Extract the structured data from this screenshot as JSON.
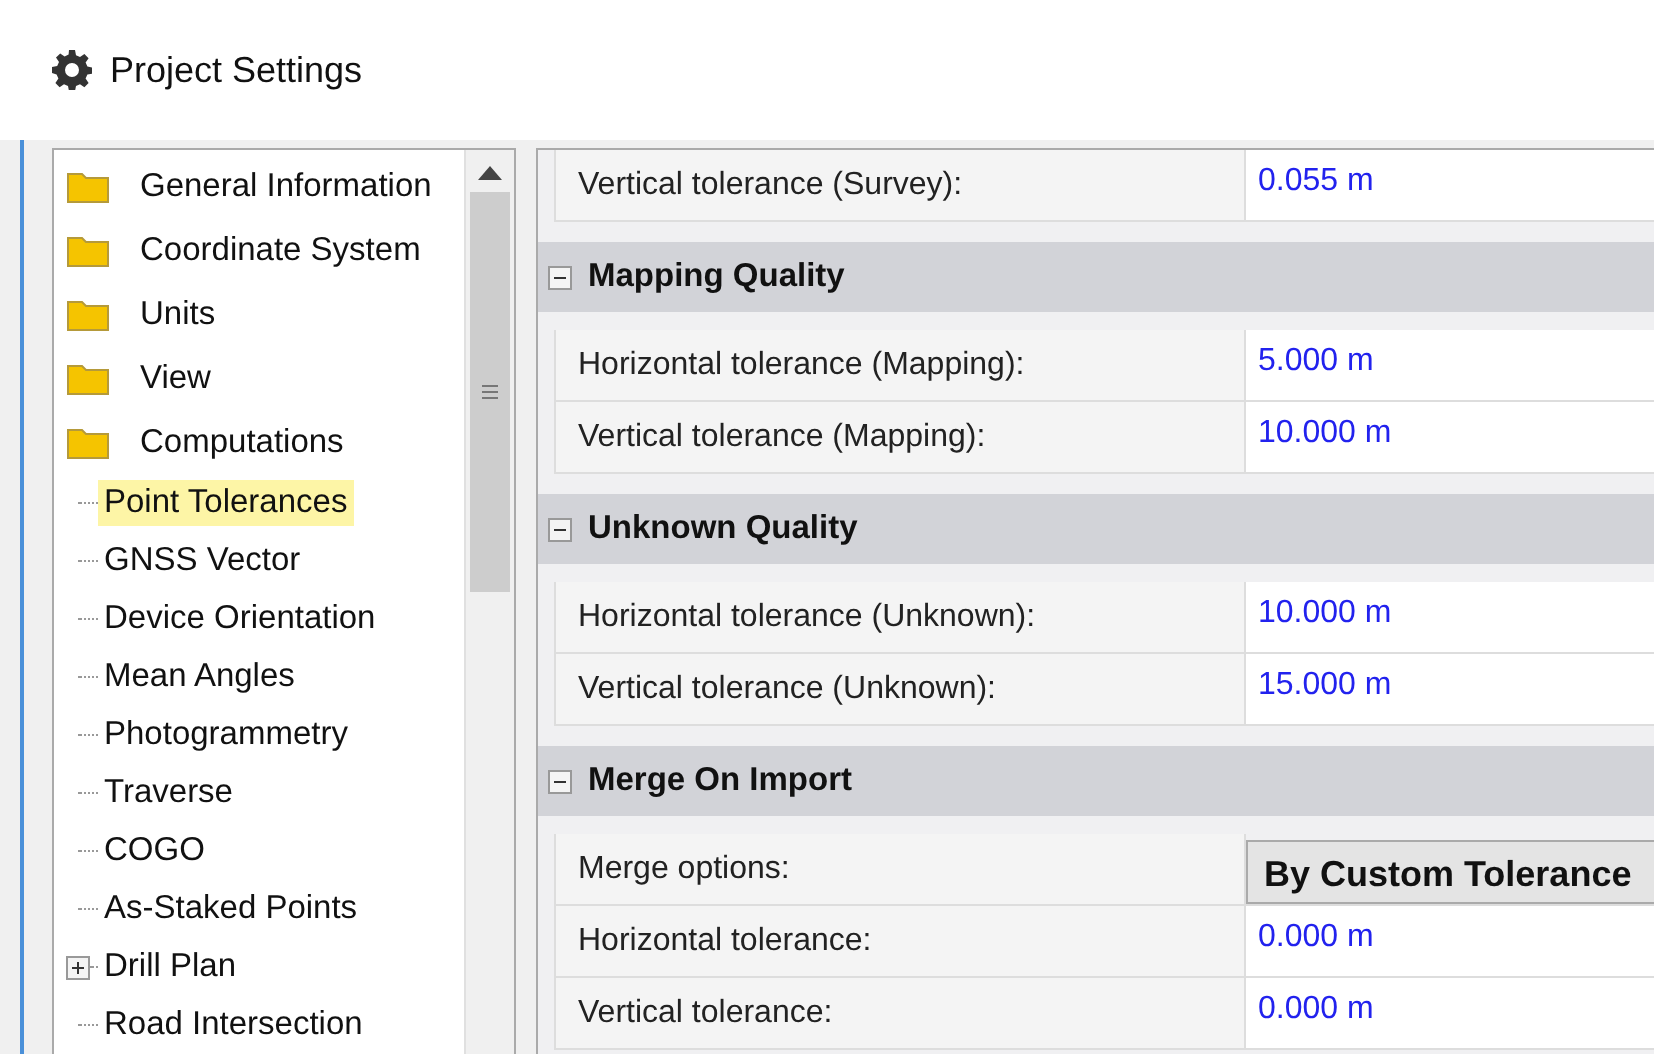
{
  "window": {
    "title": "Project Settings"
  },
  "tree": [
    {
      "label": "General Information",
      "kind": "folder",
      "selected": false
    },
    {
      "label": "Coordinate System",
      "kind": "folder",
      "selected": false
    },
    {
      "label": "Units",
      "kind": "folder",
      "selected": false
    },
    {
      "label": "View",
      "kind": "folder",
      "selected": false
    },
    {
      "label": "Computations",
      "kind": "folder",
      "selected": false,
      "children": [
        {
          "label": "Point Tolerances",
          "selected": true
        },
        {
          "label": "GNSS Vector",
          "selected": false
        },
        {
          "label": "Device Orientation",
          "selected": false
        },
        {
          "label": "Mean Angles",
          "selected": false
        },
        {
          "label": "Photogrammetry",
          "selected": false
        },
        {
          "label": "Traverse",
          "selected": false
        },
        {
          "label": "COGO",
          "selected": false
        },
        {
          "label": "As-Staked Points",
          "selected": false
        },
        {
          "label": "Drill Plan",
          "selected": false,
          "expanded": false
        },
        {
          "label": "Road Intersection",
          "selected": false
        }
      ]
    }
  ],
  "properties": [
    {
      "kind": "rows",
      "rows": [
        {
          "label": "Vertical tolerance (Survey):",
          "value": "0.055 m",
          "kind": "text"
        }
      ]
    },
    {
      "kind": "section",
      "title": "Mapping Quality",
      "expanded": true,
      "rows": [
        {
          "label": "Horizontal tolerance (Mapping):",
          "value": "5.000 m",
          "kind": "text"
        },
        {
          "label": "Vertical tolerance (Mapping):",
          "value": "10.000 m",
          "kind": "text"
        }
      ]
    },
    {
      "kind": "section",
      "title": "Unknown Quality",
      "expanded": true,
      "rows": [
        {
          "label": "Horizontal tolerance (Unknown):",
          "value": "10.000 m",
          "kind": "text"
        },
        {
          "label": "Vertical tolerance (Unknown):",
          "value": "15.000 m",
          "kind": "text"
        }
      ]
    },
    {
      "kind": "section",
      "title": "Merge On Import",
      "expanded": true,
      "rows": [
        {
          "label": "Merge options:",
          "value": "By Custom Tolerance",
          "kind": "choice"
        },
        {
          "label": "Horizontal tolerance:",
          "value": "0.000 m",
          "kind": "text"
        },
        {
          "label": "Vertical tolerance:",
          "value": "0.000 m",
          "kind": "text"
        }
      ]
    }
  ]
}
